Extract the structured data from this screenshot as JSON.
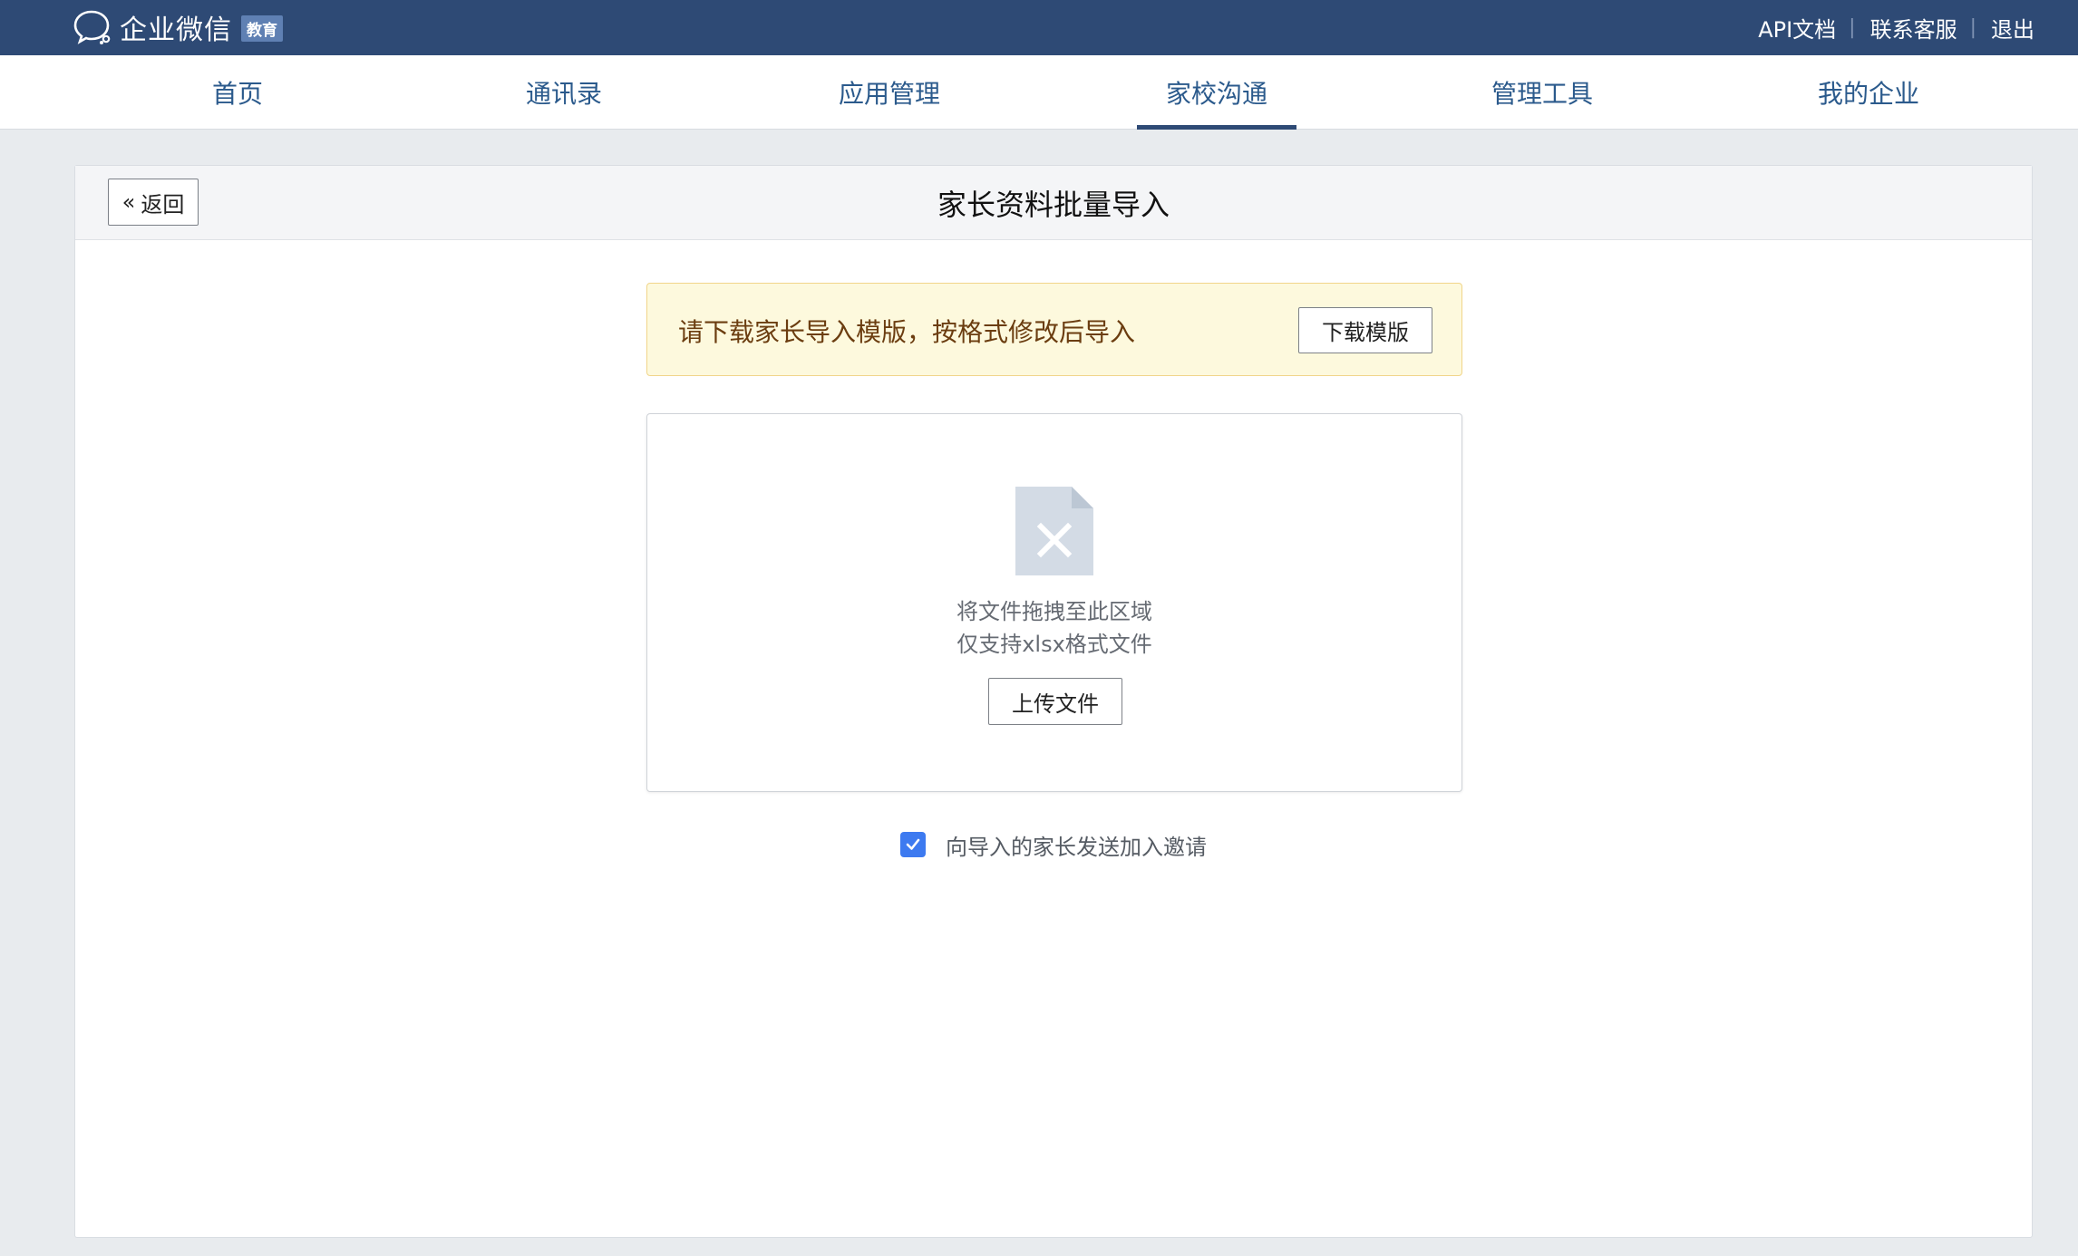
{
  "topbar": {
    "logo_text": "企业微信",
    "logo_badge": "教育",
    "links": [
      "API文档",
      "联系客服",
      "退出"
    ],
    "colors": {
      "background": "#2e4a75"
    }
  },
  "nav": {
    "items": [
      {
        "label": "首页",
        "active": false
      },
      {
        "label": "通讯录",
        "active": false
      },
      {
        "label": "应用管理",
        "active": false
      },
      {
        "label": "家校沟通",
        "active": true
      },
      {
        "label": "管理工具",
        "active": false
      },
      {
        "label": "我的企业",
        "active": false
      }
    ]
  },
  "page": {
    "back_label": "返回",
    "back_icon": "double-chevron-left-icon",
    "title": "家长资料批量导入"
  },
  "notice": {
    "text": "请下载家长导入模版，按格式修改后导入",
    "download_label": "下载模版",
    "colors": {
      "background": "#fdf9dd",
      "border": "#f1d58a",
      "text": "#6b3d10"
    }
  },
  "dropzone": {
    "icon": "excel-file-icon",
    "line1": "将文件拖拽至此区域",
    "line2": "仅支持xlsx格式文件",
    "upload_label": "上传文件"
  },
  "invite": {
    "checked": true,
    "label": "向导入的家长发送加入邀请",
    "colors": {
      "checkbox": "#3d7af0"
    }
  }
}
